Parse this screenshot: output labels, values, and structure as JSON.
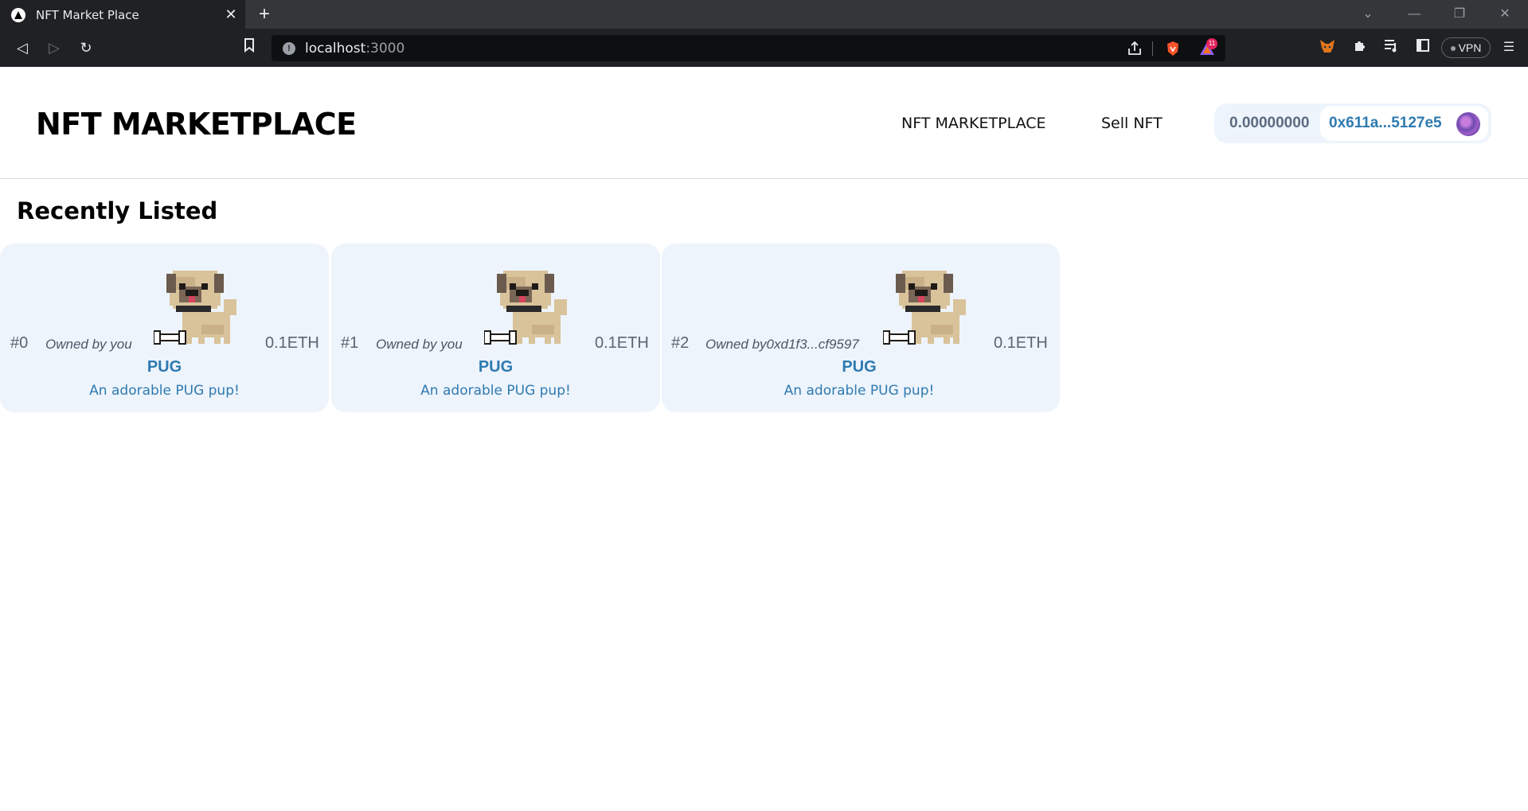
{
  "browser": {
    "tab_title": "NFT Market Place",
    "tab_close": "✕",
    "new_tab": "+",
    "url_host": "localhost",
    "url_port": ":3000",
    "brave_badge_count": "11",
    "vpn_label": "VPN"
  },
  "header": {
    "brand": "NFT MARKETPLACE",
    "nav": [
      {
        "label": "NFT MARKETPLACE"
      },
      {
        "label": "Sell NFT"
      }
    ],
    "wallet": {
      "balance": "0.00000000",
      "address": "0x611a...5127e5"
    }
  },
  "main": {
    "section_title": "Recently Listed",
    "cards": [
      {
        "id": "#0",
        "owner": "Owned by you",
        "price": "0.1ETH",
        "name": "PUG",
        "description": "An adorable PUG pup!"
      },
      {
        "id": "#1",
        "owner": "Owned by you",
        "price": "0.1ETH",
        "name": "PUG",
        "description": "An adorable PUG pup!"
      },
      {
        "id": "#2",
        "owner": "Owned by0xd1f3...cf9597",
        "price": "0.1ETH",
        "name": "PUG",
        "description": "An adorable PUG pup!"
      }
    ]
  },
  "colors": {
    "card_bg": "#eef4fc",
    "accent_blue": "#2e7ab0",
    "chrome_dark": "#202124"
  }
}
